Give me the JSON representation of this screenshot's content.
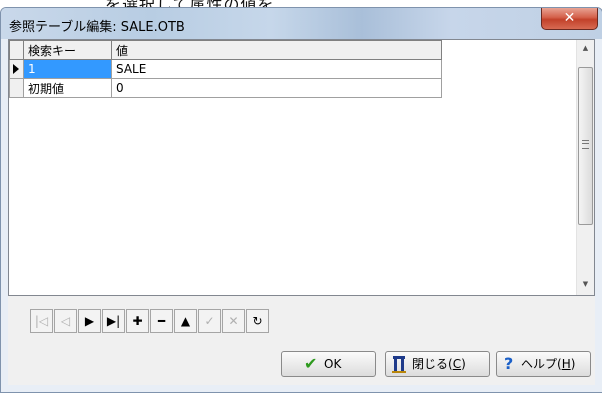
{
  "window": {
    "title": "参照テーブル編集: SALE.OTB",
    "close_glyph": "✕"
  },
  "background_text": "を選択して属性の値を",
  "grid": {
    "columns": [
      "検索キー",
      "値"
    ],
    "rows": [
      {
        "key": "1",
        "value": "SALE",
        "current": true
      },
      {
        "key": "初期値",
        "value": "0",
        "current": false
      }
    ]
  },
  "scrollbar": {
    "up": "▲",
    "down": "▼",
    "position": 0.0
  },
  "navigator": [
    {
      "name": "first",
      "glyph": "|◁",
      "enabled": false
    },
    {
      "name": "prior",
      "glyph": "◁",
      "enabled": false
    },
    {
      "name": "next",
      "glyph": "▶",
      "enabled": true
    },
    {
      "name": "last",
      "glyph": "▶|",
      "enabled": true
    },
    {
      "name": "insert",
      "glyph": "✚",
      "enabled": true
    },
    {
      "name": "delete",
      "glyph": "━",
      "enabled": true
    },
    {
      "name": "edit",
      "glyph": "▲",
      "enabled": true
    },
    {
      "name": "post",
      "glyph": "✓",
      "enabled": false
    },
    {
      "name": "cancel",
      "glyph": "✕",
      "enabled": false
    },
    {
      "name": "refresh",
      "glyph": "↻",
      "enabled": true
    }
  ],
  "buttons": {
    "ok": {
      "label": "OK",
      "icon": "✔",
      "icon_color": "#2e9a1e"
    },
    "close": {
      "label": "閉じる(",
      "mnemonic": "C",
      "suffix": ")",
      "icon": "close-door-icon"
    },
    "help": {
      "label": "ヘルプ(",
      "mnemonic": "H",
      "suffix": ")",
      "icon": "?",
      "icon_color": "#1a5fc8"
    }
  }
}
